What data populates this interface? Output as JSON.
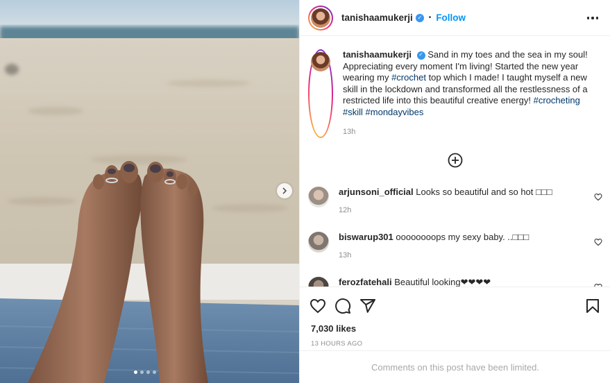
{
  "post": {
    "username": "tanishaamukerji",
    "verified_mark": "✓",
    "separator": "•",
    "follow_label": "Follow",
    "more_icon": "more-horizontal-icon"
  },
  "caption": {
    "username": "tanishaamukerji",
    "text_1": "Sand in my toes and the sea in my soul! Appreciating every moment I'm living! Started the new year wearing my ",
    "tag_crochet": "#crochet",
    "text_2": " top which I made! I taught myself a new skill in the lockdown and transformed all the restlessness of a restricted life into this beautiful creative energy! ",
    "tag_crocheting": "#crocheting",
    "tag_skill": "#skill",
    "tag_mondayvibes": "#mondayvibes",
    "time": "13h"
  },
  "comments": [
    {
      "username": "arjunsoni_official",
      "text": "Looks so beautiful and so hot □□□",
      "time": "12h"
    },
    {
      "username": "biswarup301",
      "text": "oooooooops my sexy baby. ..□□□",
      "time": "13h"
    },
    {
      "username": "ferozfatehali",
      "text": "Beautiful looking❤❤❤❤",
      "time": ""
    }
  ],
  "actions": {
    "likes": "7,030 likes",
    "posted": "13 HOURS AGO",
    "icons": [
      "heart-icon",
      "comment-icon",
      "share-icon",
      "bookmark-icon"
    ]
  },
  "footer": {
    "limited_text": "Comments on this post have been limited."
  },
  "carousel": {
    "count": 4,
    "active_index": 0
  },
  "colors": {
    "follow_blue": "#0095f6",
    "hashtag": "#00376b",
    "muted": "#8e8e8e",
    "border": "#efefef"
  }
}
